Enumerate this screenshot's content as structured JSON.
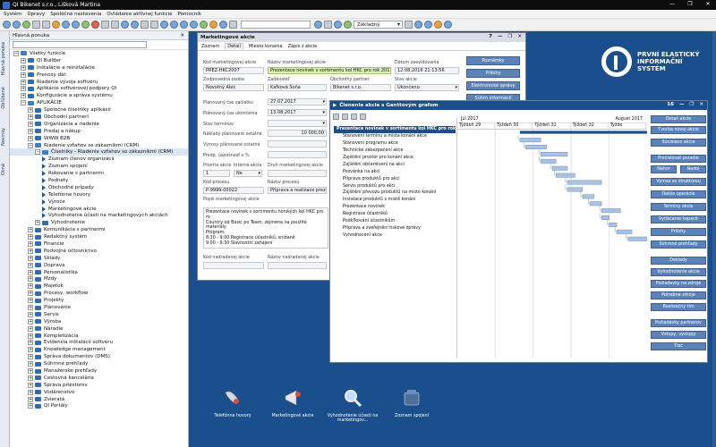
{
  "window": {
    "title": "QI  Bikenet s.r.o., Lišková Martina",
    "controls": [
      "—",
      "❐",
      "✕"
    ]
  },
  "menu": [
    "Systém",
    "Úpravy",
    "Spoločné nastavenia",
    "Ovládanie aktívnej funkcie",
    "Pomocník"
  ],
  "toolbar": {
    "mode": "Základný"
  },
  "vtabs": [
    "Hlavná ponuka",
    "Obľúbené",
    "Novinky",
    "Okná"
  ],
  "nav": {
    "title": "Hlavná ponuka",
    "close": "✕",
    "tree": [
      {
        "t": "Všetky funkcie",
        "lvl": 0,
        "k": "op"
      },
      {
        "t": "QI Builder",
        "lvl": 1,
        "k": "f"
      },
      {
        "t": "Inštalácie a reinštalácie",
        "lvl": 1,
        "k": "f"
      },
      {
        "t": "Prenosy dát",
        "lvl": 1,
        "k": "f"
      },
      {
        "t": "Riadenie vývoja softvéru",
        "lvl": 1,
        "k": "f"
      },
      {
        "t": "Aplikácie softvérovej podpory QI",
        "lvl": 1,
        "k": "f"
      },
      {
        "t": "Konfigurácie a správa systému",
        "lvl": 1,
        "k": "f"
      },
      {
        "t": "APLIKÁCIE",
        "lvl": 1,
        "k": "op"
      },
      {
        "t": "Spoločné číselníky aplikácií",
        "lvl": 2,
        "k": "f"
      },
      {
        "t": "Obchodní partneri",
        "lvl": 2,
        "k": "f"
      },
      {
        "t": "Organizácia a riadenie",
        "lvl": 2,
        "k": "f"
      },
      {
        "t": "Predaj a nákup",
        "lvl": 2,
        "k": "f"
      },
      {
        "t": "WWW B2B",
        "lvl": 2,
        "k": "f"
      },
      {
        "t": "Riadenie vzťahov so zákazníkmi (CRM)",
        "lvl": 2,
        "k": "op"
      },
      {
        "t": "Číselníky - Riadenie vzťahov so zákazníkmi (CRM)",
        "lvl": 3,
        "k": "op",
        "sel": true
      },
      {
        "t": "Zoznam členov organizácií",
        "lvl": 4,
        "k": "l"
      },
      {
        "t": "Zoznam spojení",
        "lvl": 4,
        "k": "l"
      },
      {
        "t": "Rokovanie s partnermi",
        "lvl": 4,
        "k": "l"
      },
      {
        "t": "Podnety",
        "lvl": 4,
        "k": "l"
      },
      {
        "t": "Obchodné prípady",
        "lvl": 4,
        "k": "l"
      },
      {
        "t": "Telefónne hovory",
        "lvl": 4,
        "k": "l"
      },
      {
        "t": "Výroče",
        "lvl": 4,
        "k": "l"
      },
      {
        "t": "Marketingové akcie",
        "lvl": 4,
        "k": "l"
      },
      {
        "t": "Vyhodnotenie účasti na marketingových akciách",
        "lvl": 4,
        "k": "l"
      },
      {
        "t": "Vyhodnotenie",
        "lvl": 3,
        "k": "f"
      },
      {
        "t": "Komunikácia s partnermi",
        "lvl": 2,
        "k": "f"
      },
      {
        "t": "Redakčný systém",
        "lvl": 2,
        "k": "f"
      },
      {
        "t": "Financie",
        "lvl": 2,
        "k": "f"
      },
      {
        "t": "Podvojné účtovníctvo",
        "lvl": 2,
        "k": "f"
      },
      {
        "t": "Sklady",
        "lvl": 2,
        "k": "f"
      },
      {
        "t": "Doprava",
        "lvl": 2,
        "k": "f"
      },
      {
        "t": "Personalistika",
        "lvl": 2,
        "k": "f"
      },
      {
        "t": "Mzdy",
        "lvl": 2,
        "k": "f"
      },
      {
        "t": "Majetok",
        "lvl": 2,
        "k": "f"
      },
      {
        "t": "Procesy, workflow",
        "lvl": 2,
        "k": "f"
      },
      {
        "t": "Projekty",
        "lvl": 2,
        "k": "f"
      },
      {
        "t": "Plánovanie",
        "lvl": 2,
        "k": "f"
      },
      {
        "t": "Servis",
        "lvl": 2,
        "k": "f"
      },
      {
        "t": "Výroba",
        "lvl": 2,
        "k": "f"
      },
      {
        "t": "Náradie",
        "lvl": 2,
        "k": "f"
      },
      {
        "t": "Kompletizácia",
        "lvl": 2,
        "k": "f"
      },
      {
        "t": "Evidencia inštalácií softvéru",
        "lvl": 2,
        "k": "f"
      },
      {
        "t": "Knowledge management",
        "lvl": 2,
        "k": "f"
      },
      {
        "t": "Správa dokumentov (DMS)",
        "lvl": 2,
        "k": "f"
      },
      {
        "t": "Súhrnné prehľady",
        "lvl": 2,
        "k": "f"
      },
      {
        "t": "Manažérske prehľady",
        "lvl": 2,
        "k": "f"
      },
      {
        "t": "Cestovná kancelária",
        "lvl": 2,
        "k": "f"
      },
      {
        "t": "Správa priestorov",
        "lvl": 2,
        "k": "f"
      },
      {
        "t": "Vodárenstvo",
        "lvl": 2,
        "k": "f"
      },
      {
        "t": "Zvieratá",
        "lvl": 2,
        "k": "f"
      },
      {
        "t": "QI Portály",
        "lvl": 2,
        "k": "f"
      }
    ]
  },
  "brand": {
    "line1": "PRVNÍ ELASTICKÝ",
    "line2": "INFORMAČNÍ",
    "line3": "SYSTÉM"
  },
  "mwin": {
    "title": "Marketingové akcie",
    "num": "7",
    "tabs": [
      "Zoznam",
      "Detail",
      "Miesto konania",
      "Zápis z akcie"
    ],
    "labels": {
      "code": "Kód marketingovej akcie",
      "name": "Názov marketingovej akcie",
      "entry": "Dátum zaevidovania",
      "resp": "Zodpovedná osoba",
      "assigner": "Zadávateľ",
      "partner": "Obchodný partner",
      "state": "Stav akcie",
      "plan_start": "Plánovaný čas začiatku",
      "plan_end": "Plánovaný čas ukončenia",
      "term_state": "Stav termínov",
      "cost_other": "Náklady plánované ostatné",
      "revenue": "Výnosy plánované ostatné",
      "success": "Predp. úspešnosť v %",
      "priority": "Priorita akcie",
      "internal": "Interná akcia",
      "type": "Druh marketingovej akcie",
      "proc_code": "Kód procesu",
      "proc_name": "Názov procesu",
      "desc": "Popis marketingovej akcie",
      "parent_code": "Kód nadradenej akcie",
      "parent_name": "Názov nadradenej akcie"
    },
    "values": {
      "code": "PREZ-HKC2007",
      "name": "Prezentace novinek v sortimentu kol HKC pro rok 2017",
      "entry": "12.08.2016 21:13:56",
      "resp": "Novotný Aleš",
      "assigner": "Kafková Soňa",
      "partner": "Bikenet s.r.o.",
      "state": "Ukončeno",
      "plan_start": "27.07.2017",
      "plan_end": "13.08.2017",
      "cost_other": "10 000,00",
      "priority": "1",
      "internal": "Ne",
      "proc_code": "P-9999-00022",
      "proc_name": "Příprava a realizace prezentací",
      "desc1": "Prezentace novinek v sortimentu horských kol HKC pro ro",
      "desc2": "Country od Basic po Team, zejména na použité materiály",
      "desc3": "Program:",
      "desc4": "8:30  - 9:00   Registrace účastníků, snídaně",
      "desc5": "9:00  - 9:30   Slavnostní zahájení"
    },
    "buttons": [
      "Poznámky",
      "Prílohy",
      "Elektronické správy",
      "Súhrn informácií"
    ]
  },
  "gwin": {
    "title": "Členenie akcie s Ganttovým grafom",
    "num": "16",
    "months": [
      "Júl 2017",
      "August 2017"
    ],
    "weeks": [
      "Týždeň 29",
      "Týždeň 30",
      "Týždeň 31",
      "Týždeň 32",
      "Týžde"
    ],
    "tasks": [
      {
        "name": "Prezentace novinek v sortimentu kol HKC pro rok 2017",
        "top": true,
        "s": 0.33,
        "e": 1.0
      },
      {
        "name": "Stanovení termínu a místa konání akce",
        "s": 0.33,
        "e": 0.44
      },
      {
        "name": "Stanovení programu akce",
        "s": 0.36,
        "e": 0.47
      },
      {
        "name": "Technické zabezpečení akce",
        "s": 0.44,
        "e": 0.58
      },
      {
        "name": "Zajištění prostor pro konání akce",
        "s": 0.44,
        "e": 0.52
      },
      {
        "name": "Zajištění občerstvení na akci",
        "s": 0.5,
        "e": 0.58
      },
      {
        "name": "Pozvánka na akci",
        "s": 0.52,
        "e": 0.62
      },
      {
        "name": "Příprava produktů pro akci",
        "s": 0.58,
        "e": 0.76
      },
      {
        "name": "Servis produktů pro akci",
        "s": 0.58,
        "e": 0.66
      },
      {
        "name": "Zajištění převozu produktů na místo konání",
        "s": 0.66,
        "e": 0.72
      },
      {
        "name": "Instalace produktů v místě konání",
        "s": 0.7,
        "e": 0.76
      },
      {
        "name": "Prezentace novinek",
        "s": 0.76,
        "e": 0.86
      },
      {
        "name": "Registrace účastníků",
        "s": 0.76,
        "e": 0.8
      },
      {
        "name": "Podkľkování účastníkům",
        "s": 0.8,
        "e": 0.84
      },
      {
        "name": "Příprava a zveřejnění tiskové zprávy",
        "s": 0.84,
        "e": 0.92
      },
      {
        "name": "Vyhodnocení akce",
        "s": 0.9,
        "e": 1.0
      }
    ],
    "buttons": [
      "Detail akcie",
      "Tvorba novej akcie",
      "Súvisiace akcie",
      "Prečíslovať poradie",
      "Nahor",
      "Nadol",
      "Výmaz so štruktúrou",
      "Ďalšie operácie",
      "Termíny akcie",
      "Vytláčanie kapacít",
      "Prílohy",
      "Súhrnné prehľady",
      "Doklady",
      "Vyhodnotenie akcie",
      "Požiadavky na zdroje",
      "Potrebné zdroje",
      "Realizačný tím",
      "Požiadavky partnerov",
      "Vstupy, výstupy",
      "Tlač"
    ]
  },
  "shortcuts": [
    "Telefónne hovory",
    "Marketingové akcie",
    "Vyhodnotenie účasti na marketingov...",
    "Zoznam spojení"
  ]
}
